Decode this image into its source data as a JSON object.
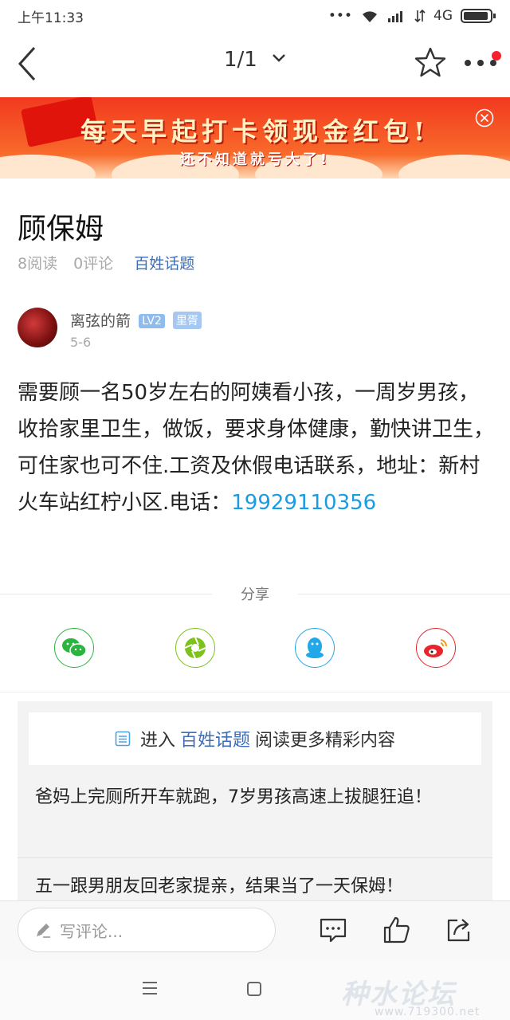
{
  "status_bar": {
    "time": "上午11:33",
    "dots": "•••",
    "network": "4G"
  },
  "nav": {
    "page_indicator": "1/1"
  },
  "banner": {
    "title": "每天早起打卡领现金红包!",
    "subtitle": "还不知道就亏大了!"
  },
  "article": {
    "title": "顾保姆",
    "reads": "8阅读",
    "comments": "0评论",
    "topic": "百姓话题",
    "author": {
      "name": "离弦的箭",
      "level_badge": "LV2",
      "role_badge": "里胥",
      "date": "5-6"
    },
    "body": "需要顾一名50岁左右的阿姨看小孩，一周岁男孩，收拾家里卫生，做饭，要求身体健康，勤快讲卫生，可住家也可不住.工资及休假电话联系，地址：新村火车站红柠小区.电话：",
    "phone": "19929110356"
  },
  "share": {
    "label": "分享",
    "icons": [
      "wechat-icon",
      "moments-icon",
      "qq-icon",
      "weibo-icon"
    ],
    "colors": {
      "wechat": "#2bb540",
      "moments": "#7cc21a",
      "qq": "#20a8e8",
      "weibo": "#e6262c"
    }
  },
  "related": {
    "enter_prefix": "进入",
    "enter_topic": "百姓话题",
    "enter_suffix": "阅读更多精彩内容",
    "items": [
      "爸妈上完厕所开车就跑，7岁男孩高速上拔腿狂追！",
      "五一跟男朋友回老家提亲，结果当了一天保姆！"
    ]
  },
  "comment_bar": {
    "placeholder": "写评论..."
  },
  "watermark": {
    "text": "种水论坛",
    "url": "www.719300.net"
  }
}
